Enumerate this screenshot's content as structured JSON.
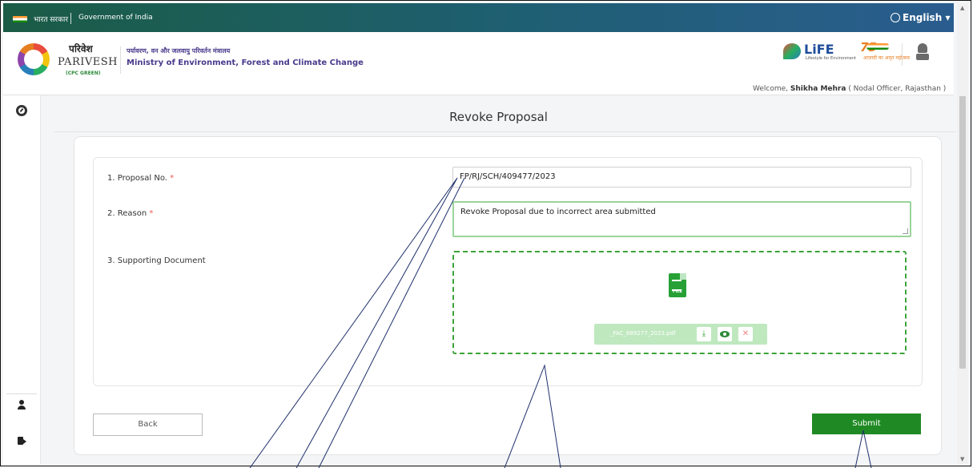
{
  "govbar": {
    "hindi": "भारत सरकार",
    "english": "Government of India",
    "language": "English"
  },
  "header": {
    "brand_hindi": "परिवेश",
    "brand_english": "PARIVESH",
    "brand_sub": "(CPC GREEN)",
    "ministry_hindi": "पर्यावरण, वन और जलवायु परिवर्तन मंत्रालय",
    "ministry_english": "Ministry of Environment, Forest and Climate Change",
    "life_text": "LiFE",
    "life_sub": "Lifestyle for Environment",
    "azadi_num": "75",
    "azadi_text": "आज़ादी का अमृत महोत्सव",
    "welcome_prefix": "Welcome, ",
    "welcome_name": "Shikha Mehra",
    "welcome_role": " ( Nodal Officer, Rajasthan )"
  },
  "page": {
    "title": "Revoke Proposal"
  },
  "form": {
    "proposal_label": "1. Proposal No.",
    "proposal_value": "FP/RJ/SCH/409477/2023",
    "reason_label": "2. Reason",
    "reason_value": "Revoke Proposal due to incorrect area submitted",
    "doc_label": "3. Supporting Document",
    "file_tag": "FILE",
    "file_name": "_FAC_689277_2023.pdf",
    "required_mark": "*"
  },
  "buttons": {
    "back": "Back",
    "submit": "Submit"
  },
  "icons": {
    "dashboard": "dashboard-icon",
    "user": "user-icon",
    "logout": "logout-icon",
    "download": "download-icon",
    "view": "eye-icon",
    "remove": "close-icon",
    "globe": "globe-icon"
  },
  "colors": {
    "primary_green": "#1f8a24",
    "gov_bar": "#1f5f73",
    "dropzone_border": "#3aa33a"
  }
}
